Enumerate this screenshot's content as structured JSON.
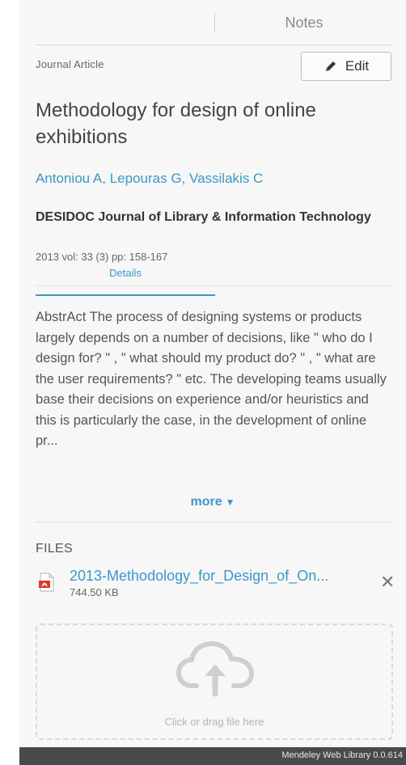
{
  "tabs": [
    {
      "label": "Details",
      "active": true
    },
    {
      "label": "Notes",
      "active": false
    }
  ],
  "document": {
    "type": "Journal Article",
    "edit_label": "Edit",
    "title": "Methodology for design of online exhibitions",
    "authors": [
      "Antoniou A",
      "Lepouras G",
      "Vassilakis C"
    ],
    "journal": "DESIDOC Journal of Library & Information Technology",
    "details": "2013 vol: 33 (3) pp: 158-167",
    "abstract": "AbstrAct The process of designing systems or products largely depends on a number of decisions, like \" who do I design for? \" , \" what should my product do? \" , \" what are the user requirements? \" etc. The developing teams usually base their decisions on experience and/or heuristics and this is particularly the case, in the development of online pr...",
    "more_label": "more"
  },
  "files": {
    "heading": "FILES",
    "items": [
      {
        "name": "2013-Methodology_for_Design_of_On...",
        "size": "744.50 KB",
        "icon": "pdf-icon"
      }
    ],
    "dropzone_label": "Click or drag file here"
  },
  "footer": {
    "text": "Mendeley Web Library 0.0.614"
  },
  "colors": {
    "accent": "#3b97c8",
    "footer_bg": "#4a4a4a",
    "pdf_red": "#d93a2e"
  }
}
